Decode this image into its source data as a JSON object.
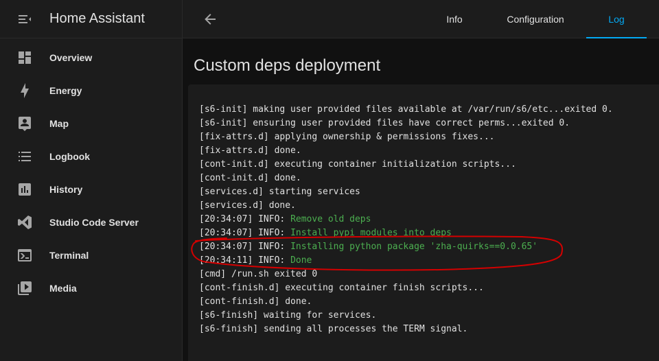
{
  "sidebar": {
    "title": "Home Assistant",
    "items": [
      {
        "label": "Overview",
        "icon": "dashboard-icon"
      },
      {
        "label": "Energy",
        "icon": "lightning-icon"
      },
      {
        "label": "Map",
        "icon": "map-person-icon"
      },
      {
        "label": "Logbook",
        "icon": "list-icon"
      },
      {
        "label": "History",
        "icon": "chart-icon"
      },
      {
        "label": "Studio Code Server",
        "icon": "vscode-icon"
      },
      {
        "label": "Terminal",
        "icon": "console-icon"
      },
      {
        "label": "Media",
        "icon": "play-box-icon"
      }
    ]
  },
  "topbar": {
    "tabs": [
      "Info",
      "Configuration",
      "Log"
    ],
    "active_tab": "Log"
  },
  "page": {
    "title": "Custom deps deployment"
  },
  "log": [
    {
      "prefix": "[s6-init] making user provided files available at /var/run/s6/etc...exited 0.",
      "message": ""
    },
    {
      "prefix": "[s6-init] ensuring user provided files have correct perms...exited 0.",
      "message": ""
    },
    {
      "prefix": "[fix-attrs.d] applying ownership & permissions fixes...",
      "message": ""
    },
    {
      "prefix": "[fix-attrs.d] done.",
      "message": ""
    },
    {
      "prefix": "[cont-init.d] executing container initialization scripts...",
      "message": ""
    },
    {
      "prefix": "[cont-init.d] done.",
      "message": ""
    },
    {
      "prefix": "[services.d] starting services",
      "message": ""
    },
    {
      "prefix": "[services.d] done.",
      "message": ""
    },
    {
      "prefix": "[20:34:07] INFO: ",
      "message": "Remove old deps"
    },
    {
      "prefix": "[20:34:07] INFO: ",
      "message": "Install pypi modules into deps"
    },
    {
      "prefix": "[20:34:07] INFO: ",
      "message": "Installing python package 'zha-quirks==0.0.65'"
    },
    {
      "prefix": "[20:34:11] INFO: ",
      "message": "Done"
    },
    {
      "prefix": "[cmd] /run.sh exited 0",
      "message": ""
    },
    {
      "prefix": "[cont-finish.d] executing container finish scripts...",
      "message": ""
    },
    {
      "prefix": "[cont-finish.d] done.",
      "message": ""
    },
    {
      "prefix": "[s6-finish] waiting for services.",
      "message": ""
    },
    {
      "prefix": "[s6-finish] sending all processes the TERM signal.",
      "message": ""
    }
  ],
  "colors": {
    "accent": "#03a9f4",
    "log_info_message": "#4caf50",
    "annotation": "#d50000"
  }
}
